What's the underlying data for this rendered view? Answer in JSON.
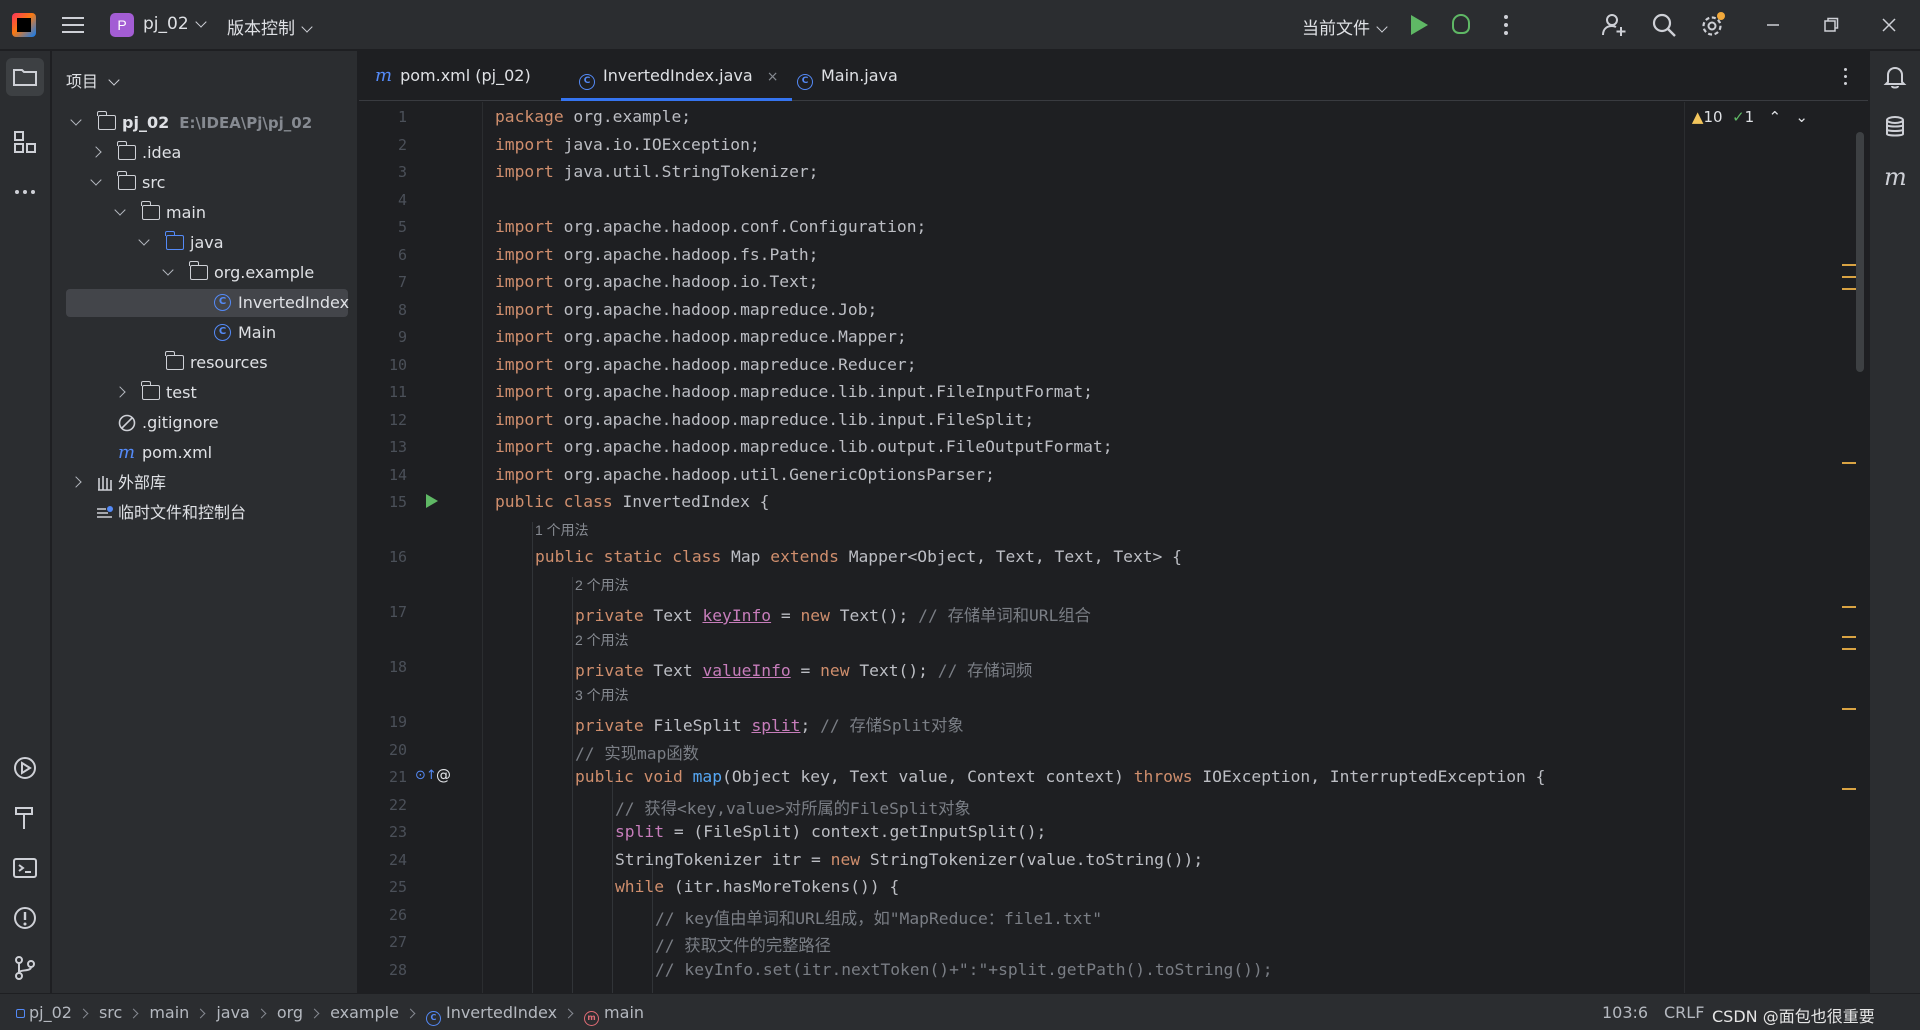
{
  "titlebar": {
    "project_badge": "P",
    "project_name": "pj_02",
    "vcs_label": "版本控制",
    "run_config": "当前文件"
  },
  "icons": {
    "app": "intellij-logo-icon",
    "menu": "hamburger-icon",
    "run": "run-icon",
    "debug": "debug-icon",
    "more": "more-icon",
    "add_user": "add-user-icon",
    "search": "search-icon",
    "settings": "gear-icon"
  },
  "project_panel": {
    "title": "项目",
    "tree": [
      {
        "label": "pj_02",
        "hint": "E:\\IDEA\\Pj\\pj_02"
      },
      {
        "label": ".idea"
      },
      {
        "label": "src"
      },
      {
        "label": "main"
      },
      {
        "label": "java"
      },
      {
        "label": "org.example"
      },
      {
        "label": "InvertedIndex"
      },
      {
        "label": "Main"
      },
      {
        "label": "resources"
      },
      {
        "label": "test"
      },
      {
        "label": ".gitignore"
      },
      {
        "label": "pom.xml"
      },
      {
        "label": "外部库"
      },
      {
        "label": "临时文件和控制台"
      }
    ]
  },
  "tabs": [
    {
      "label": "pom.xml (pj_02)"
    },
    {
      "label": "InvertedIndex.java",
      "close": "×"
    },
    {
      "label": "Main.java"
    }
  ],
  "inspections": {
    "warnings": "10",
    "weak": "1"
  },
  "hints": [
    "1 个用法",
    "2 个用法",
    "2 个用法",
    "3 个用法"
  ],
  "line_numbers": [
    "1",
    "2",
    "3",
    "4",
    "5",
    "6",
    "7",
    "8",
    "9",
    "10",
    "11",
    "12",
    "13",
    "14",
    "15",
    "16",
    "17",
    "18",
    "19",
    "20",
    "21",
    "22",
    "23",
    "24",
    "25",
    "26",
    "27",
    "28"
  ],
  "code": {
    "l1_kw": "package",
    "l1": " org.example;",
    "imp": "import",
    "l2": " java.io.IOException;",
    "l3": " java.util.StringTokenizer;",
    "l5": " org.apache.hadoop.conf.Configuration;",
    "l6": " org.apache.hadoop.fs.Path;",
    "l7": " org.apache.hadoop.io.Text;",
    "l8": " org.apache.hadoop.mapreduce.Job;",
    "l9": " org.apache.hadoop.mapreduce.Mapper;",
    "l10": " org.apache.hadoop.mapreduce.Reducer;",
    "l11": " org.apache.hadoop.mapreduce.lib.input.FileInputFormat;",
    "l12": " org.apache.hadoop.mapreduce.lib.input.FileSplit;",
    "l13": " org.apache.hadoop.mapreduce.lib.output.FileOutputFormat;",
    "l14": " org.apache.hadoop.util.GenericOptionsParser;",
    "l15_kw": "public class",
    "l15": " InvertedIndex {",
    "l16_kw1": "public static class",
    "l16_a": " Map ",
    "l16_kw2": "extends",
    "l16_b": " Mapper<Object, Text, Text, Text> {",
    "l17_kw": "private",
    "l17_a": " Text ",
    "l17_f": "keyInfo",
    "l17_b": " = ",
    "l17_kw2": "new",
    "l17_c": " Text(); ",
    "l17_cm": "// 存储单词和URL组合",
    "l18_kw": "private",
    "l18_a": " Text ",
    "l18_f": "valueInfo",
    "l18_b": " = ",
    "l18_kw2": "new",
    "l18_c": " Text(); ",
    "l18_cm": "// 存储词频",
    "l19_kw": "private",
    "l19_a": " FileSplit ",
    "l19_f": "split",
    "l19_b": "; ",
    "l19_cm": "// 存储Split对象",
    "l20_cm": "// 实现map函数",
    "l21_kw": "public void",
    "l21_fn": " map",
    "l21_a": "(Object key, Text value, Context context) ",
    "l21_kw2": "throws",
    "l21_b": " IOException, InterruptedException {",
    "l22_cm": "// 获得<key,value>对所属的FileSplit对象",
    "l23_f": "split",
    "l23": " = (FileSplit) context.getInputSplit();",
    "l24_a": "StringTokenizer itr = ",
    "l24_kw": "new",
    "l24_b": " StringTokenizer(value.toString());",
    "l25_kw": "while",
    "l25": " (itr.hasMoreTokens()) {",
    "l26_cm": "// key值由单词和URL组成，如\"MapReduce：file1.txt\"",
    "l27_cm": "// 获取文件的完整路径",
    "l28_cm": "// keyInfo.set(itr.nextToken()+\":\"+split.getPath().toString());"
  },
  "statusbar": {
    "breadcrumbs": [
      "pj_02",
      "src",
      "main",
      "java",
      "org",
      "example",
      "InvertedIndex",
      "main"
    ],
    "position": "103:6",
    "line_sep": "CRLF",
    "watermark": "CSDN @面包也很重要"
  }
}
